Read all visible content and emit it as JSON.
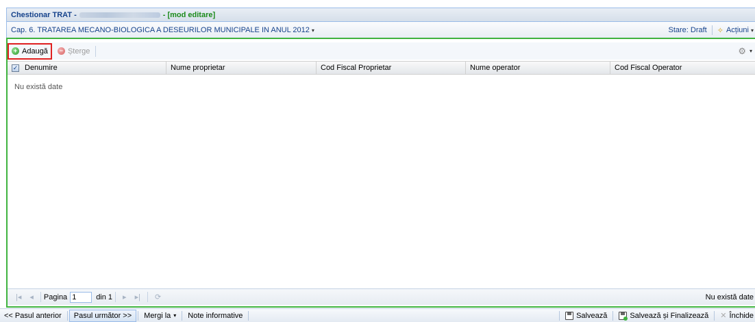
{
  "window": {
    "title_prefix": "Chestionar TRAT -",
    "title_suffix": "- [mod editare]"
  },
  "chapter": {
    "title": "Cap. 6. TRATAREA MECANO-BIOLOGICA A DESEURILOR MUNICIPALE IN ANUL 2012",
    "status": "Stare: Draft",
    "actions_label": "Acțiuni"
  },
  "toolbar": {
    "add_label": "Adaugă",
    "delete_label": "Șterge"
  },
  "grid": {
    "columns": [
      "Denumire",
      "Nume proprietar",
      "Cod Fiscal Proprietar",
      "Nume operator",
      "Cod Fiscal Operator"
    ],
    "empty_text": "Nu există date"
  },
  "paging": {
    "page_label": "Pagina",
    "page_value": "1",
    "of_label": "din 1",
    "status": "Nu există date"
  },
  "bottom": {
    "prev": "<< Pasul anterior",
    "next": "Pasul următor >>",
    "goto": "Mergi la",
    "notes": "Note informative",
    "save": "Salvează",
    "save_finalize": "Salvează și Finalizează",
    "close": "Închide"
  },
  "colors": {
    "accent_green": "#3fb33f",
    "highlight_red": "#e02020",
    "header_blue": "#15428b"
  }
}
